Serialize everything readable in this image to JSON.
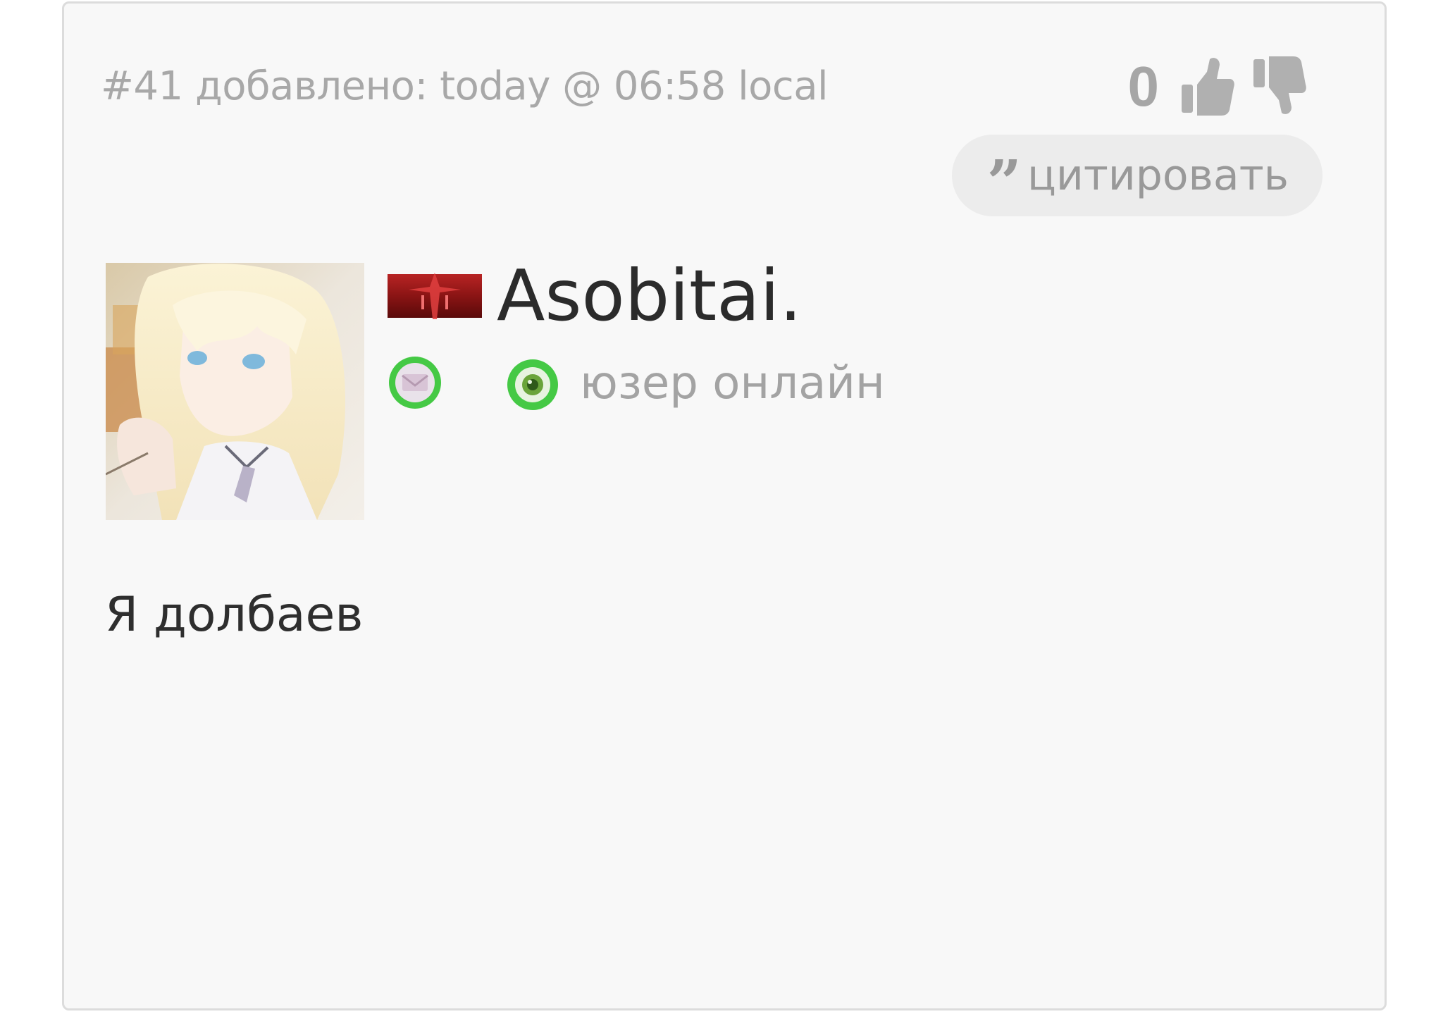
{
  "post": {
    "meta": "#41 добавлено: today @ 06:58 local",
    "vote_count": "0",
    "quote_label": "цитировать",
    "quote_icon": "”",
    "author": {
      "username": "Asobitai.",
      "status": "юзер онлайн"
    },
    "message": "Я долбаев"
  },
  "icons": {
    "like": "thumbs-up-icon",
    "dislike": "thumbs-down-icon",
    "pm": "envelope-icon",
    "online": "online-status-icon",
    "rank": "rank-badge-icon"
  },
  "colors": {
    "card_background": "#f8f8f8",
    "card_border": "#dcdcdc",
    "muted_text": "#a8a8a8",
    "button_background": "#ececec",
    "body_text": "#2e2e2e",
    "status_green": "#3fc93f",
    "badge_red": "#9d1d1d"
  }
}
